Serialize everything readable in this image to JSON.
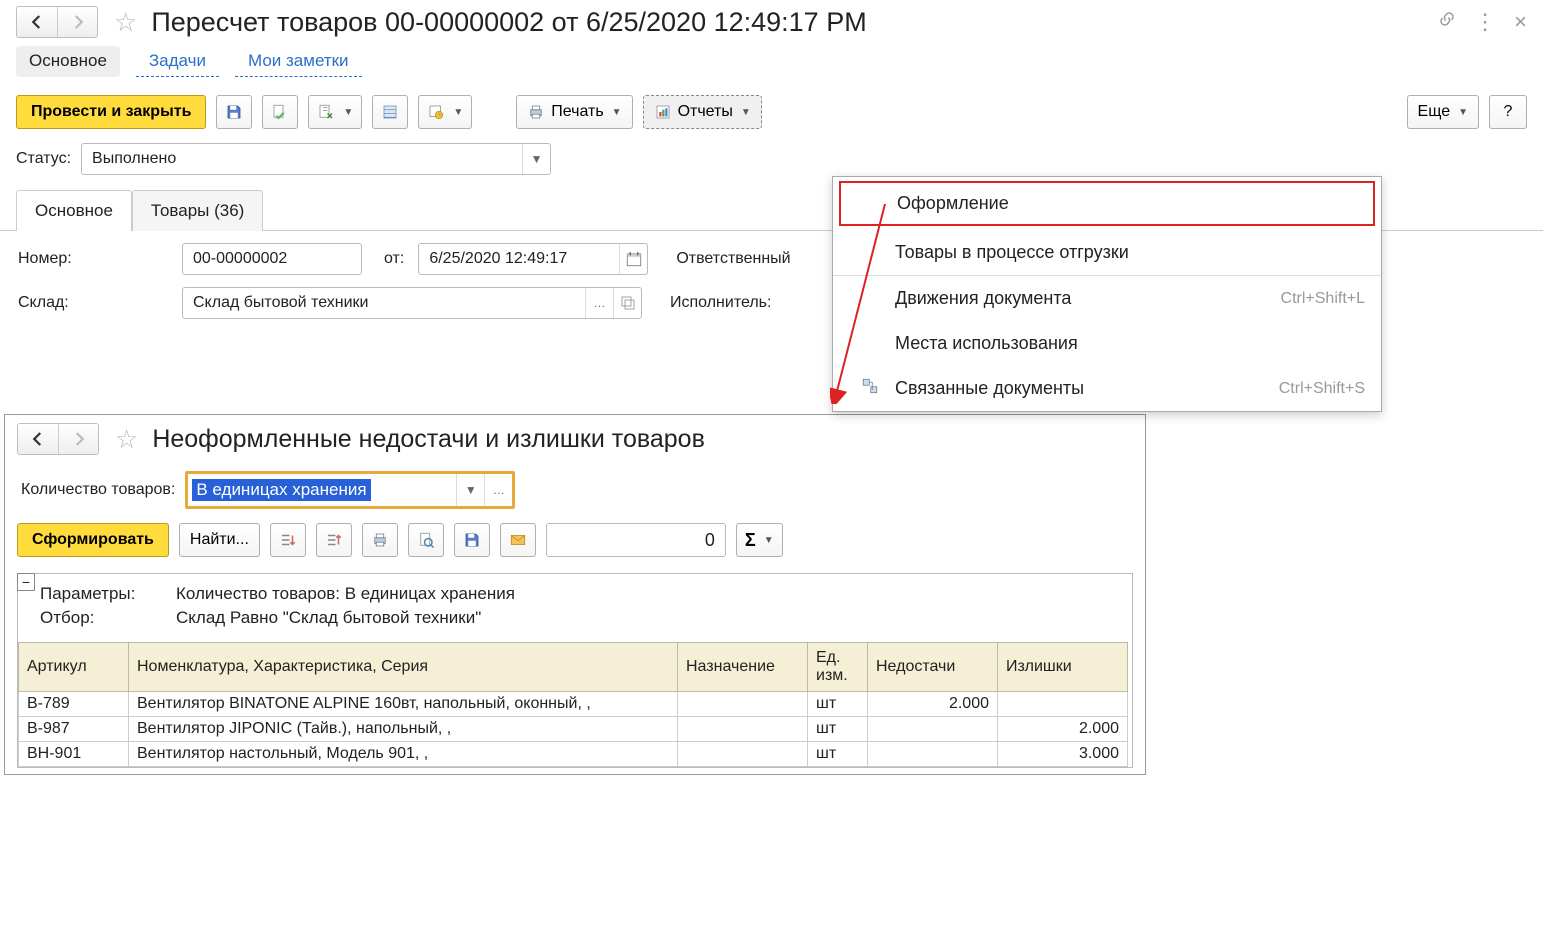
{
  "header": {
    "title": "Пересчет товаров 00-00000002 от 6/25/2020 12:49:17 PM"
  },
  "nav": {
    "main": "Основное",
    "tasks": "Задачи",
    "notes": "Мои заметки"
  },
  "toolbar": {
    "post_close": "Провести и закрыть",
    "print": "Печать",
    "reports": "Отчеты",
    "more": "Еще",
    "help": "?"
  },
  "status": {
    "label": "Статус:",
    "value": "Выполнено"
  },
  "tabs": {
    "main": "Основное",
    "goods": "Товары (36)"
  },
  "detail": {
    "number_label": "Номер:",
    "number_value": "00-00000002",
    "date_label": "от:",
    "date_value": "6/25/2020 12:49:17",
    "responsible_label": "Ответственный",
    "warehouse_label": "Склад:",
    "warehouse_value": "Склад бытовой техники",
    "executor_label": "Исполнитель:"
  },
  "reports_menu": {
    "item1": "Оформление",
    "item2": "Товары в процессе отгрузки",
    "item3": "Движения документа",
    "item3_sc": "Ctrl+Shift+L",
    "item4": "Места использования",
    "item5": "Связанные документы",
    "item5_sc": "Ctrl+Shift+S"
  },
  "report": {
    "title": "Неоформленные недостачи и излишки товаров",
    "qty_label": "Количество товаров:",
    "qty_value": "В единицах хранения",
    "generate": "Сформировать",
    "find": "Найти...",
    "numbox": "0",
    "params_label": "Параметры:",
    "params_value": "Количество товаров: В единицах хранения",
    "filter_label": "Отбор:",
    "filter_value": "Склад Равно \"Склад бытовой техники\"",
    "cols": {
      "article": "Артикул",
      "name": "Номенклатура, Характеристика, Серия",
      "purpose": "Назначение",
      "unit": "Ед. изм.",
      "shortage": "Недостачи",
      "surplus": "Излишки"
    },
    "rows": [
      {
        "article": "B-789",
        "name": "Вентилятор BINATONE ALPINE 160вт, напольный, оконный, ,",
        "purpose": "",
        "unit": "шт",
        "shortage": "2.000",
        "surplus": ""
      },
      {
        "article": "B-987",
        "name": "Вентилятор JIPONIC (Тайв.), напольный, ,",
        "purpose": "",
        "unit": "шт",
        "shortage": "",
        "surplus": "2.000"
      },
      {
        "article": "BH-901",
        "name": "Вентилятор настольный, Модель 901, ,",
        "purpose": "",
        "unit": "шт",
        "shortage": "",
        "surplus": "3.000"
      }
    ]
  }
}
